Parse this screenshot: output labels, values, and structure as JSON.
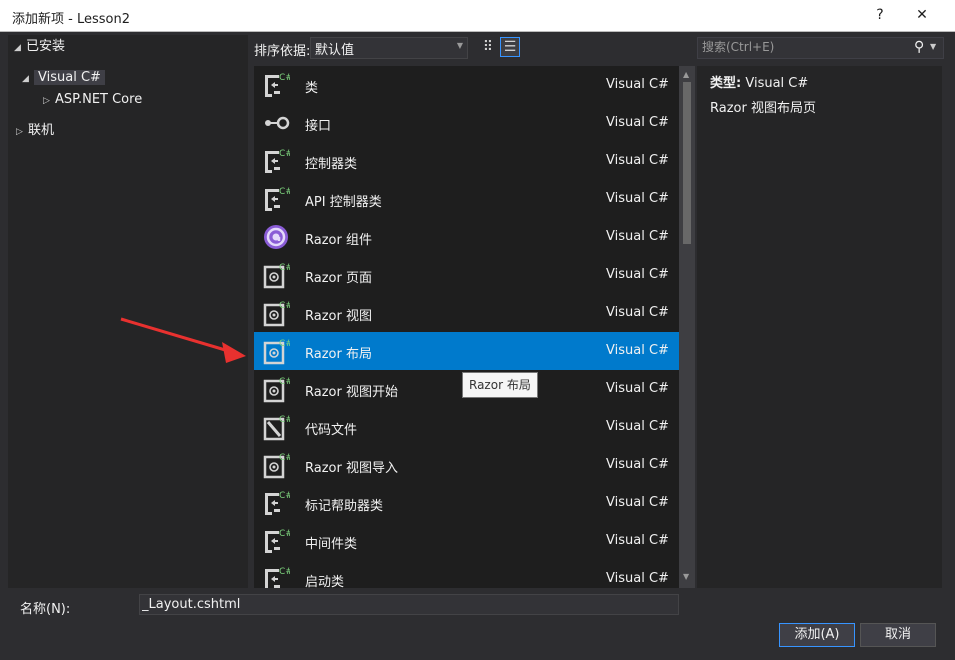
{
  "window": {
    "title": "添加新项 - Lesson2",
    "help_glyph": "?",
    "close_glyph": "✕"
  },
  "left_tree": {
    "installed": "已安装",
    "visual_csharp": "Visual C#",
    "aspnet_core": "ASP.NET Core",
    "online": "联机"
  },
  "sort": {
    "label": "排序依据:",
    "value": "默认值"
  },
  "search": {
    "placeholder": "搜索(Ctrl+E)"
  },
  "templates": [
    {
      "name": "类",
      "lang": "Visual C#",
      "icon": "class-icon"
    },
    {
      "name": "接口",
      "lang": "Visual C#",
      "icon": "interface-icon"
    },
    {
      "name": "控制器类",
      "lang": "Visual C#",
      "icon": "class-icon"
    },
    {
      "name": "API 控制器类",
      "lang": "Visual C#",
      "icon": "class-icon"
    },
    {
      "name": "Razor 组件",
      "lang": "Visual C#",
      "icon": "razor-component-icon"
    },
    {
      "name": "Razor 页面",
      "lang": "Visual C#",
      "icon": "razor-page-icon"
    },
    {
      "name": "Razor 视图",
      "lang": "Visual C#",
      "icon": "razor-page-icon"
    },
    {
      "name": "Razor 布局",
      "lang": "Visual C#",
      "icon": "razor-page-icon"
    },
    {
      "name": "Razor 视图开始",
      "lang": "Visual C#",
      "icon": "razor-page-icon"
    },
    {
      "name": "代码文件",
      "lang": "Visual C#",
      "icon": "code-file-icon"
    },
    {
      "name": "Razor 视图导入",
      "lang": "Visual C#",
      "icon": "razor-page-icon"
    },
    {
      "name": "标记帮助器类",
      "lang": "Visual C#",
      "icon": "class-icon"
    },
    {
      "name": "中间件类",
      "lang": "Visual C#",
      "icon": "class-icon"
    },
    {
      "name": "启动类",
      "lang": "Visual C#",
      "icon": "class-icon"
    }
  ],
  "selected_index": 7,
  "tooltip": "Razor 布局",
  "details": {
    "type_label": "类型:",
    "type_value": "Visual C#",
    "description": "Razor 视图布局页"
  },
  "name_field": {
    "label": "名称(N):",
    "value": "_Layout.cshtml"
  },
  "buttons": {
    "add": "添加(A)",
    "cancel": "取消"
  },
  "colors": {
    "accent": "#007acc",
    "annotation_arrow": "#e8312f",
    "razor_purple": "#8a5cd6"
  }
}
